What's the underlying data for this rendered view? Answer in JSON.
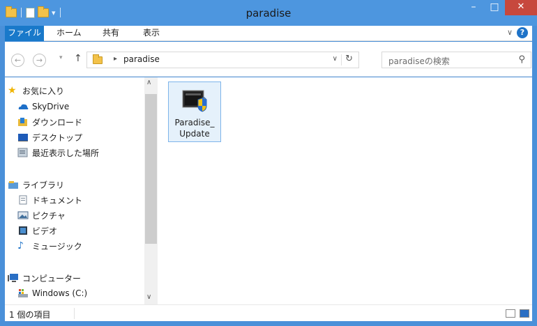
{
  "window": {
    "title": "paradise",
    "controls": {
      "minimize": "–",
      "maximize": "□",
      "close": "✕"
    }
  },
  "ribbon": {
    "tabs": [
      {
        "label": "ファイル"
      },
      {
        "label": "ホーム"
      },
      {
        "label": "共有"
      },
      {
        "label": "表示"
      }
    ]
  },
  "address": {
    "crumb": "paradise",
    "search_placeholder": "paradiseの検索"
  },
  "navpane": {
    "favorites": {
      "label": "お気に入り",
      "items": [
        {
          "label": "SkyDrive",
          "icon": "skydrive-icon"
        },
        {
          "label": "ダウンロード",
          "icon": "downloads-folder-icon"
        },
        {
          "label": "デスクトップ",
          "icon": "desktop-icon"
        },
        {
          "label": "最近表示した場所",
          "icon": "recent-places-icon"
        }
      ]
    },
    "libraries": {
      "label": "ライブラリ",
      "items": [
        {
          "label": "ドキュメント",
          "icon": "documents-icon"
        },
        {
          "label": "ピクチャ",
          "icon": "pictures-icon"
        },
        {
          "label": "ビデオ",
          "icon": "videos-icon"
        },
        {
          "label": "ミュージック",
          "icon": "music-icon"
        }
      ]
    },
    "computer": {
      "label": "コンピューター",
      "items": [
        {
          "label": "Windows (C:)",
          "icon": "drive-icon"
        }
      ]
    }
  },
  "files": [
    {
      "name": "Paradise_\nUpdate",
      "icon": "installer-shield-icon"
    }
  ],
  "status": {
    "count": "1 個の項目"
  },
  "colors": {
    "titlebar": "#4d96df",
    "file_tab": "#1979ca",
    "selection": "#e5f1fb",
    "close": "#c7483d"
  }
}
